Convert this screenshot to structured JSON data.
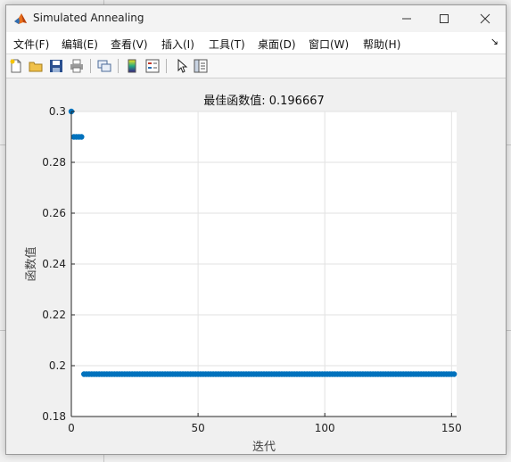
{
  "window": {
    "title": "Simulated Annealing",
    "controls": [
      "minimize",
      "maximize",
      "close"
    ]
  },
  "menu": [
    "文件(F)",
    "编辑(E)",
    "查看(V)",
    "插入(I)",
    "工具(T)",
    "桌面(D)",
    "窗口(W)",
    "帮助(H)"
  ],
  "toolbar": [
    "new-figure-icon",
    "open-icon",
    "save-icon",
    "print-icon",
    "link-plot-icon",
    "insert-colorbar-icon",
    "insert-legend-icon",
    "edit-plot-icon",
    "property-inspector-icon"
  ],
  "chart_data": {
    "type": "scatter",
    "title": "最佳函数值: 0.196667",
    "xlabel": "迭代",
    "ylabel": "函数值",
    "xlim": [
      0,
      152
    ],
    "ylim": [
      0.18,
      0.3
    ],
    "xticks": [
      "0",
      "50",
      "100",
      "150"
    ],
    "yticks": [
      "0.18",
      "0.2",
      "0.22",
      "0.24",
      "0.26",
      "0.28",
      "0.3"
    ],
    "grid": true,
    "marker_color": "#0072BD",
    "segments": [
      {
        "x_from": 0,
        "x_to": 0,
        "y": 0.3
      },
      {
        "x_from": 1,
        "x_to": 4,
        "y": 0.29
      },
      {
        "x_from": 5,
        "x_to": 151,
        "y": 0.196667
      }
    ]
  }
}
